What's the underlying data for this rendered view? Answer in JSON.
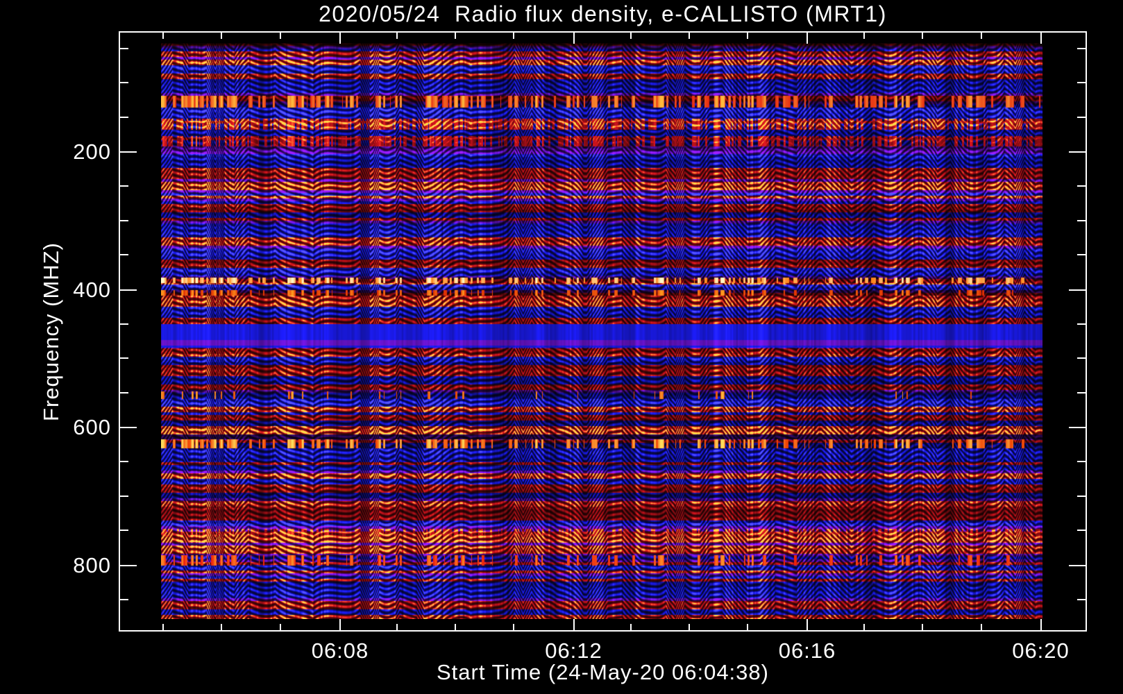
{
  "page": {
    "background": "#000000",
    "text_color": "#ffffff"
  },
  "chart_data": {
    "type": "heatmap",
    "subtype": "radio-spectrogram",
    "title": "2020/05/24  Radio flux density, e-CALLISTO (MRT1)",
    "instrument": "e-CALLISTO (MRT1)",
    "date": "2020/05/24",
    "x_axis": {
      "label": "Start Time (24-May-20 06:04:38)",
      "start_time": "06:04:38",
      "end_time": "06:20",
      "major_tick_labels": [
        "06:08",
        "06:12",
        "06:16",
        "06:20"
      ],
      "minor_tick_interval": "1 minute"
    },
    "y_axis": {
      "label": "Frequency (MHZ)",
      "major_tick_labels": [
        "200",
        "400",
        "600",
        "800"
      ],
      "major_tick_values_mhz": [
        200,
        400,
        600,
        800
      ],
      "minor_tick_interval_mhz": 50,
      "range_mhz": [
        45,
        870
      ],
      "orientation": "frequency increases downward"
    },
    "grid": false,
    "legend": "none",
    "colormap": {
      "background_low": "#000000",
      "quiet": "#2323e6",
      "intermediate": "#7a28c8",
      "active": "#d91e14",
      "strong": "#ff9a28",
      "peak": "#ffe9a0"
    },
    "pattern_note": "Broadband zig-zag interference fringes: blue background rows, red noisy rows, black diagonal chevron fringes, strong vertical striping.",
    "features": [
      {
        "name": "rfi-band-130mhz",
        "freq_mhz": [
          118,
          135
        ],
        "style": "bright-dashes",
        "threshold": 0.4,
        "color_from": "#e62810",
        "color_to": "#ffb93c"
      },
      {
        "name": "red-band-160mhz",
        "freq_mhz": [
          152,
          167
        ],
        "style": "red-dashes",
        "threshold": 0.3
      },
      {
        "name": "red-band-185mhz",
        "freq_mhz": [
          177,
          191
        ],
        "style": "red-dashes",
        "threshold": 0.42
      },
      {
        "name": "bright-line-385mhz",
        "freq_mhz": [
          382,
          389
        ],
        "style": "bright-dashes",
        "threshold": 0.44,
        "color_from": "#ff8214",
        "color_to": "#fffac8"
      },
      {
        "name": "orange-band-404mhz",
        "freq_mhz": [
          400,
          408
        ],
        "style": "bright-dashes",
        "threshold": 0.52,
        "color_from": "#dc2800",
        "color_to": "#ff961e"
      },
      {
        "name": "smooth-blue-band-465mhz",
        "freq_mhz": [
          450,
          483
        ],
        "style": "smooth-blue"
      },
      {
        "name": "sparse-dashes-553mhz",
        "freq_mhz": [
          548,
          558
        ],
        "style": "bright-dashes",
        "threshold": 0.72,
        "color_from": "#e63c00",
        "color_to": "#ffbe3c"
      },
      {
        "name": "dark-lane-613mhz",
        "freq_mhz": [
          610,
          617
        ],
        "style": "dark-lane"
      },
      {
        "name": "bright-line-623mhz",
        "freq_mhz": [
          617,
          629
        ],
        "style": "bright-dashes",
        "threshold": 0.46,
        "color_from": "#f03c00",
        "color_to": "#ffdc5a"
      },
      {
        "name": "red-band-752mhz",
        "freq_mhz": [
          747,
          757
        ],
        "style": "red-dashes",
        "threshold": 0.5
      },
      {
        "name": "red-band-792mhz",
        "freq_mhz": [
          785,
          799
        ],
        "style": "bright-dashes",
        "threshold": 0.55,
        "color_from": "#eb1e0a",
        "color_to": "#ff8c28"
      }
    ]
  }
}
